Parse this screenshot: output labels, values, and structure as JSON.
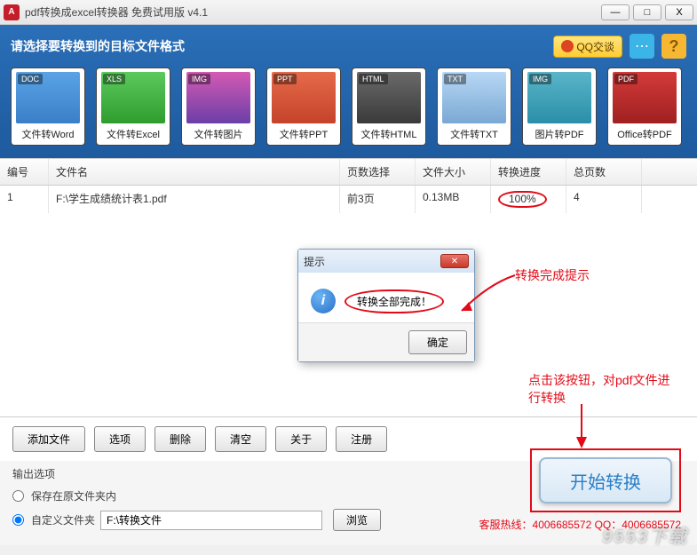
{
  "window": {
    "title": "pdf转换成excel转换器 免费试用版 v4.1",
    "min": "—",
    "max": "□",
    "close": "X"
  },
  "header": {
    "title": "请选择要转换到的目标文件格式",
    "qq_label": "QQ交谈",
    "chat_icon": "💬",
    "help_icon": "?"
  },
  "formats": [
    {
      "badge": "DOC",
      "label": "文件转Word"
    },
    {
      "badge": "XLS",
      "label": "文件转Excel"
    },
    {
      "badge": "IMG",
      "label": "文件转图片"
    },
    {
      "badge": "PPT",
      "label": "文件转PPT"
    },
    {
      "badge": "HTML",
      "label": "文件转HTML"
    },
    {
      "badge": "TXT",
      "label": "文件转TXT"
    },
    {
      "badge": "IMG",
      "label": "图片转PDF"
    },
    {
      "badge": "PDF",
      "label": "Office转PDF"
    }
  ],
  "table": {
    "headers": {
      "num": "编号",
      "name": "文件名",
      "pages": "页数选择",
      "size": "文件大小",
      "progress": "转换进度",
      "total": "总页数"
    },
    "rows": [
      {
        "num": "1",
        "name": "F:\\学生成绩统计表1.pdf",
        "pages": "前3页",
        "size": "0.13MB",
        "progress": "100%",
        "total": "4"
      }
    ]
  },
  "dialog": {
    "title": "提示",
    "message": "转换全部完成！",
    "ok": "确定"
  },
  "annotations": {
    "complete_tip": "转换完成提示",
    "click_tip": "点击该按钮，对pdf文件进行转换"
  },
  "buttons": {
    "add": "添加文件",
    "options": "选项",
    "delete": "删除",
    "clear": "清空",
    "about": "关于",
    "register": "注册"
  },
  "output": {
    "title": "输出选项",
    "radio_same": "保存在原文件夹内",
    "radio_custom": "自定义文件夹",
    "path": "F:\\转换文件",
    "browse": "浏览"
  },
  "start": "开始转换",
  "hotline": "客服热线：4006685572 QQ：4006685572",
  "watermark": "9553下载"
}
